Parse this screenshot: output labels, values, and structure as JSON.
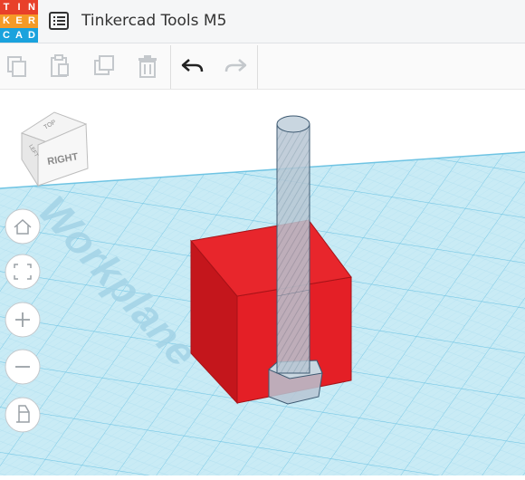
{
  "app": {
    "logo_letters": [
      "T",
      "I",
      "N",
      "K",
      "E",
      "R",
      "C",
      "A",
      "D"
    ],
    "logo_colors": [
      "#e8402a",
      "#e8402a",
      "#e8402a",
      "#f59a27",
      "#f59a27",
      "#f59a27",
      "#1aa2dd",
      "#1aa2dd",
      "#1aa2dd"
    ],
    "title": "Tinkercad Tools M5"
  },
  "toolbar": {
    "buttons": [
      "copy-icon",
      "paste-icon",
      "duplicate-icon",
      "delete-icon",
      "undo-icon",
      "redo-icon"
    ]
  },
  "viewcube": {
    "front_label": "RIGHT",
    "top_label": "TOP",
    "left_label": "LEFT"
  },
  "workplane": {
    "label": "Workplane",
    "colors": {
      "plane": "#c9ebf5",
      "grid_major": "#6fc4e3",
      "grid_minor": "#a9dcee"
    }
  },
  "shapes": {
    "box_color": "#e41f26",
    "hole_color": "#a8bccb"
  },
  "nav_controls": [
    "home-view-icon",
    "fit-view-icon",
    "zoom-in-icon",
    "zoom-out-icon",
    "perspective-icon"
  ]
}
